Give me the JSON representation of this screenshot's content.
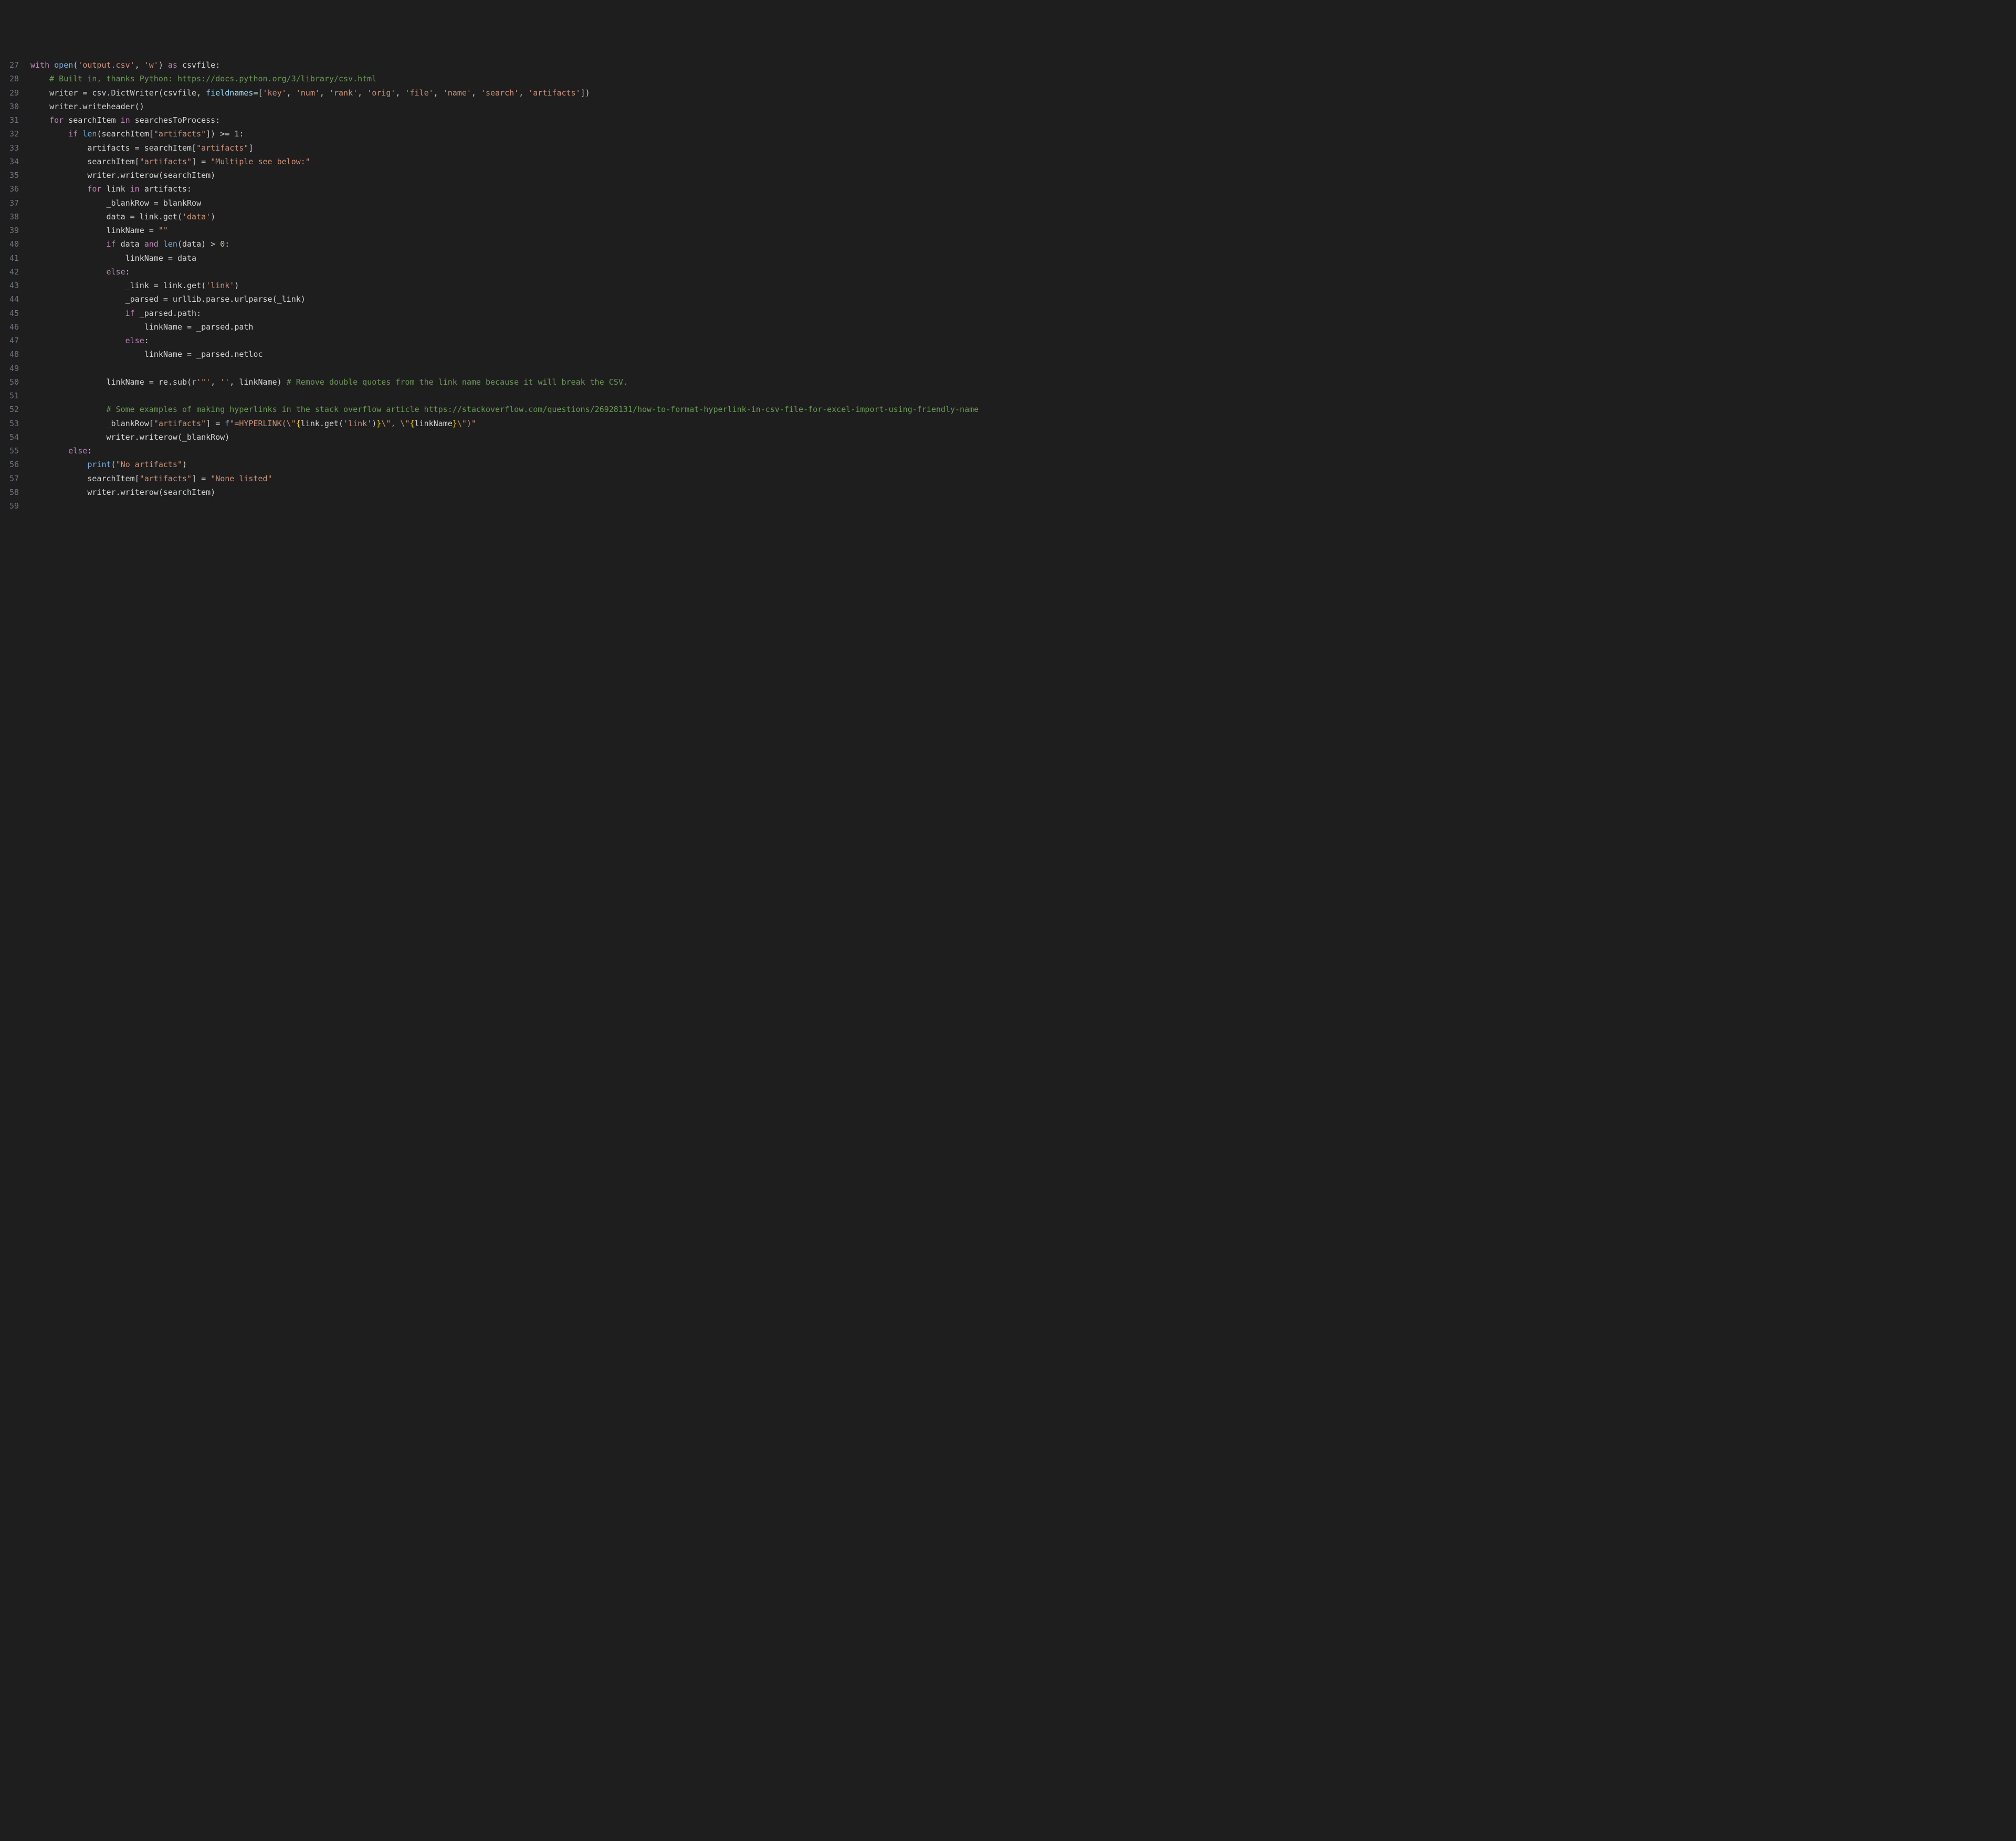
{
  "startLine": 27,
  "lines": [
    {
      "sp": 0,
      "seg": [
        {
          "c": "kw",
          "t": "with"
        },
        {
          "c": "var",
          "t": " "
        },
        {
          "c": "fn",
          "t": "open"
        },
        {
          "c": "var",
          "t": "("
        },
        {
          "c": "str",
          "t": "'output.csv'"
        },
        {
          "c": "var",
          "t": ", "
        },
        {
          "c": "str",
          "t": "'w'"
        },
        {
          "c": "var",
          "t": ") "
        },
        {
          "c": "kw",
          "t": "as"
        },
        {
          "c": "var",
          "t": " csvfile:"
        }
      ]
    },
    {
      "sp": 4,
      "seg": [
        {
          "c": "cmt",
          "t": "# Built in, thanks Python: https://docs.python.org/3/library/csv.html"
        }
      ]
    },
    {
      "sp": 4,
      "seg": [
        {
          "c": "var",
          "t": "writer = csv.DictWriter(csvfile, "
        },
        {
          "c": "param",
          "t": "fieldnames"
        },
        {
          "c": "var",
          "t": "=["
        },
        {
          "c": "str",
          "t": "'key'"
        },
        {
          "c": "var",
          "t": ", "
        },
        {
          "c": "str",
          "t": "'num'"
        },
        {
          "c": "var",
          "t": ", "
        },
        {
          "c": "str",
          "t": "'rank'"
        },
        {
          "c": "var",
          "t": ", "
        },
        {
          "c": "str",
          "t": "'orig'"
        },
        {
          "c": "var",
          "t": ", "
        },
        {
          "c": "str",
          "t": "'file'"
        },
        {
          "c": "var",
          "t": ", "
        },
        {
          "c": "str",
          "t": "'name'"
        },
        {
          "c": "var",
          "t": ", "
        },
        {
          "c": "str",
          "t": "'search'"
        },
        {
          "c": "var",
          "t": ", "
        },
        {
          "c": "str",
          "t": "'artifacts'"
        },
        {
          "c": "var",
          "t": "])"
        }
      ]
    },
    {
      "sp": 4,
      "seg": [
        {
          "c": "var",
          "t": "writer.writeheader()"
        }
      ]
    },
    {
      "sp": 4,
      "seg": [
        {
          "c": "kw",
          "t": "for"
        },
        {
          "c": "var",
          "t": " searchItem "
        },
        {
          "c": "kw",
          "t": "in"
        },
        {
          "c": "var",
          "t": " searchesToProcess:"
        }
      ]
    },
    {
      "sp": 8,
      "seg": [
        {
          "c": "kw",
          "t": "if"
        },
        {
          "c": "var",
          "t": " "
        },
        {
          "c": "fn",
          "t": "len"
        },
        {
          "c": "var",
          "t": "(searchItem["
        },
        {
          "c": "str",
          "t": "\"artifacts\""
        },
        {
          "c": "var",
          "t": "]) >= "
        },
        {
          "c": "num",
          "t": "1"
        },
        {
          "c": "var",
          "t": ":"
        }
      ]
    },
    {
      "sp": 12,
      "seg": [
        {
          "c": "var",
          "t": "artifacts = searchItem["
        },
        {
          "c": "str",
          "t": "\"artifacts\""
        },
        {
          "c": "var",
          "t": "]"
        }
      ]
    },
    {
      "sp": 12,
      "seg": [
        {
          "c": "var",
          "t": "searchItem["
        },
        {
          "c": "str",
          "t": "\"artifacts\""
        },
        {
          "c": "var",
          "t": "] = "
        },
        {
          "c": "str",
          "t": "\"Multiple see below:\""
        }
      ]
    },
    {
      "sp": 12,
      "seg": [
        {
          "c": "var",
          "t": "writer.writerow(searchItem)"
        }
      ]
    },
    {
      "sp": 12,
      "seg": [
        {
          "c": "kw",
          "t": "for"
        },
        {
          "c": "var",
          "t": " link "
        },
        {
          "c": "kw",
          "t": "in"
        },
        {
          "c": "var",
          "t": " artifacts:"
        }
      ]
    },
    {
      "sp": 16,
      "seg": [
        {
          "c": "var",
          "t": "_blankRow = blankRow"
        }
      ]
    },
    {
      "sp": 16,
      "seg": [
        {
          "c": "var",
          "t": "data = link.get("
        },
        {
          "c": "str",
          "t": "'data'"
        },
        {
          "c": "var",
          "t": ")"
        }
      ]
    },
    {
      "sp": 16,
      "seg": [
        {
          "c": "var",
          "t": "linkName = "
        },
        {
          "c": "str",
          "t": "\"\""
        }
      ]
    },
    {
      "sp": 16,
      "seg": [
        {
          "c": "kw",
          "t": "if"
        },
        {
          "c": "var",
          "t": " data "
        },
        {
          "c": "kw",
          "t": "and"
        },
        {
          "c": "var",
          "t": " "
        },
        {
          "c": "fn",
          "t": "len"
        },
        {
          "c": "var",
          "t": "(data) > "
        },
        {
          "c": "num",
          "t": "0"
        },
        {
          "c": "var",
          "t": ":"
        }
      ]
    },
    {
      "sp": 20,
      "seg": [
        {
          "c": "var",
          "t": "linkName = data"
        }
      ]
    },
    {
      "sp": 16,
      "seg": [
        {
          "c": "kw",
          "t": "else"
        },
        {
          "c": "var",
          "t": ":"
        }
      ]
    },
    {
      "sp": 20,
      "seg": [
        {
          "c": "var",
          "t": "_link = link.get("
        },
        {
          "c": "str",
          "t": "'link'"
        },
        {
          "c": "var",
          "t": ")"
        }
      ]
    },
    {
      "sp": 20,
      "seg": [
        {
          "c": "var",
          "t": "_parsed = urllib.parse.urlparse(_link)"
        }
      ]
    },
    {
      "sp": 20,
      "seg": [
        {
          "c": "kw",
          "t": "if"
        },
        {
          "c": "var",
          "t": " _parsed.path:"
        }
      ]
    },
    {
      "sp": 24,
      "seg": [
        {
          "c": "var",
          "t": "linkName = _parsed.path"
        }
      ]
    },
    {
      "sp": 20,
      "seg": [
        {
          "c": "kw",
          "t": "else"
        },
        {
          "c": "var",
          "t": ":"
        }
      ]
    },
    {
      "sp": 24,
      "seg": [
        {
          "c": "var",
          "t": "linkName = _parsed.netloc"
        }
      ]
    },
    {
      "sp": 0,
      "seg": [
        {
          "c": "var",
          "t": ""
        }
      ]
    },
    {
      "sp": 16,
      "seg": [
        {
          "c": "var",
          "t": "linkName = re.sub("
        },
        {
          "c": "fn",
          "t": "r"
        },
        {
          "c": "str",
          "t": "'\"'"
        },
        {
          "c": "var",
          "t": ", "
        },
        {
          "c": "str",
          "t": "''"
        },
        {
          "c": "var",
          "t": ", linkName) "
        },
        {
          "c": "cmt",
          "t": "# Remove double quotes from the link name because it will break the CSV."
        }
      ]
    },
    {
      "sp": 0,
      "seg": [
        {
          "c": "var",
          "t": ""
        }
      ]
    },
    {
      "sp": 16,
      "seg": [
        {
          "c": "cmt",
          "t": "# Some examples of making hyperlinks in the stack overflow article https://stackoverflow.com/questions/26928131/how-to-format-hyperlink-in-csv-file-for-excel-import-using-friendly-name"
        }
      ]
    },
    {
      "sp": 16,
      "seg": [
        {
          "c": "var",
          "t": "_blankRow["
        },
        {
          "c": "str",
          "t": "\"artifacts\""
        },
        {
          "c": "var",
          "t": "] = "
        },
        {
          "c": "fn",
          "t": "f"
        },
        {
          "c": "str",
          "t": "\"=HYPERLINK(\\\""
        },
        {
          "c": "brace",
          "t": "{"
        },
        {
          "c": "var",
          "t": "link.get("
        },
        {
          "c": "str",
          "t": "'link'"
        },
        {
          "c": "var",
          "t": ")"
        },
        {
          "c": "brace",
          "t": "}"
        },
        {
          "c": "str",
          "t": "\\\", \\\""
        },
        {
          "c": "brace",
          "t": "{"
        },
        {
          "c": "var",
          "t": "linkName"
        },
        {
          "c": "brace",
          "t": "}"
        },
        {
          "c": "str",
          "t": "\\\")\""
        }
      ]
    },
    {
      "sp": 16,
      "seg": [
        {
          "c": "var",
          "t": "writer.writerow(_blankRow)"
        }
      ]
    },
    {
      "sp": 8,
      "seg": [
        {
          "c": "kw",
          "t": "else"
        },
        {
          "c": "var",
          "t": ":"
        }
      ]
    },
    {
      "sp": 12,
      "seg": [
        {
          "c": "fn",
          "t": "print"
        },
        {
          "c": "var",
          "t": "("
        },
        {
          "c": "str",
          "t": "\"No artifacts\""
        },
        {
          "c": "var",
          "t": ")"
        }
      ]
    },
    {
      "sp": 12,
      "seg": [
        {
          "c": "var",
          "t": "searchItem["
        },
        {
          "c": "str",
          "t": "\"artifacts\""
        },
        {
          "c": "var",
          "t": "] = "
        },
        {
          "c": "str",
          "t": "\"None listed\""
        }
      ]
    },
    {
      "sp": 12,
      "seg": [
        {
          "c": "var",
          "t": "writer.writerow(searchItem)"
        }
      ]
    },
    {
      "sp": 0,
      "seg": [
        {
          "c": "var",
          "t": ""
        }
      ]
    }
  ]
}
